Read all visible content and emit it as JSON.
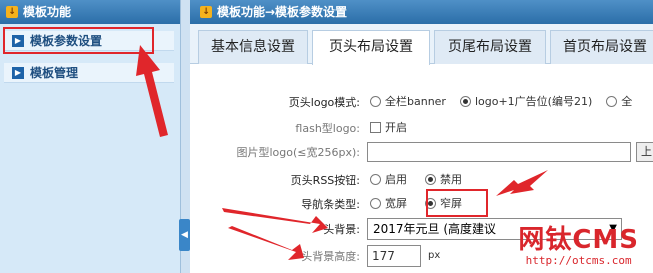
{
  "sidebar": {
    "title": "模板功能",
    "items": [
      {
        "label": "模板参数设置"
      },
      {
        "label": "模板管理"
      }
    ]
  },
  "main": {
    "breadcrumb": "模板功能→模板参数设置",
    "tabs": [
      {
        "label": "基本信息设置"
      },
      {
        "label": "页头布局设置"
      },
      {
        "label": "页尾布局设置"
      },
      {
        "label": "首页布局设置"
      }
    ],
    "active_tab": 1,
    "form": {
      "logo_mode": {
        "label": "页头logo模式:",
        "options": [
          "全栏banner",
          "logo+1广告位(编号21)",
          "全"
        ],
        "selected": 1
      },
      "flash_logo": {
        "label": "flash型logo:",
        "option": "开启"
      },
      "image_logo": {
        "label": "图片型logo(≤宽256px):",
        "value": "",
        "button": "上"
      },
      "rss_button": {
        "label": "页头RSS按钮:",
        "options": [
          "启用",
          "禁用"
        ],
        "selected": 1
      },
      "nav_type": {
        "label": "导航条类型:",
        "options": [
          "宽屏",
          "窄屏"
        ],
        "selected": 1
      },
      "header_bg": {
        "label": "头背景:",
        "value": "2017年元旦 (高度建议"
      },
      "header_bg_height": {
        "label": "头背景高度:",
        "value": "177",
        "unit": "px"
      }
    }
  },
  "watermark": {
    "brand": "网钛CMS",
    "url": "http://otcms.com"
  },
  "colors": {
    "accent_red": "#e0262b",
    "header_blue": "#2b6ea8",
    "sidebar_bg": "#d6e9f8"
  }
}
